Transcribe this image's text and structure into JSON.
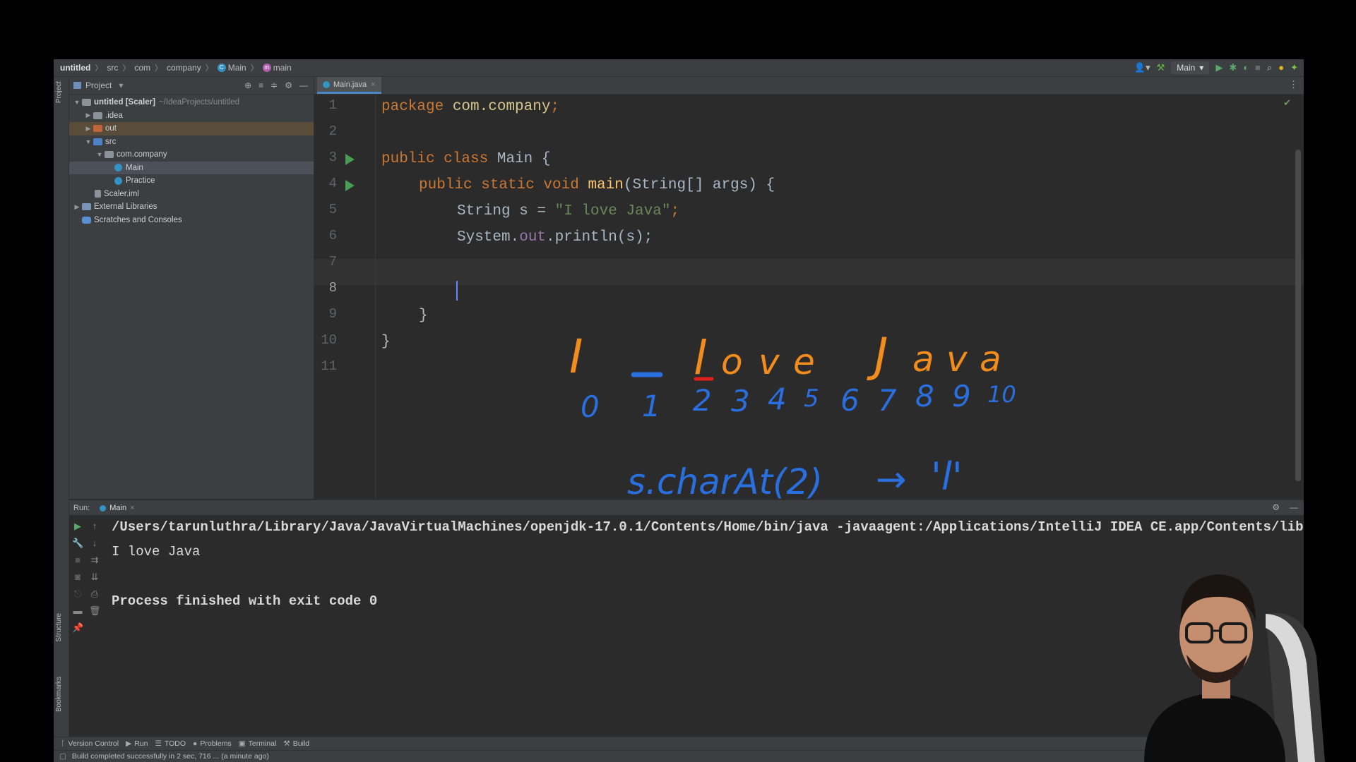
{
  "breadcrumb": [
    "untitled",
    "src",
    "com",
    "company",
    "Main",
    "main"
  ],
  "toolbar": {
    "run_config": "Main"
  },
  "project_panel": {
    "title": "Project",
    "tree": [
      {
        "label": "untitled [Scaler]",
        "path": "~/IdeaProjects/untitled"
      },
      {
        "label": ".idea"
      },
      {
        "label": "out"
      },
      {
        "label": "src"
      },
      {
        "label": "com.company"
      },
      {
        "label": "Main"
      },
      {
        "label": "Practice"
      },
      {
        "label": "Scaler.iml"
      },
      {
        "label": "External Libraries"
      },
      {
        "label": "Scratches and Consoles"
      }
    ]
  },
  "side_labels": {
    "project": "Project",
    "structure": "Structure",
    "bookmarks": "Bookmarks"
  },
  "editor": {
    "tab": "Main.java",
    "line_numbers": [
      "1",
      "2",
      "3",
      "4",
      "5",
      "6",
      "7",
      "8",
      "9",
      "10",
      "11"
    ],
    "code": {
      "l1_kw": "package",
      "l1_pkg": "com.company",
      "l1_end": ";",
      "l3_kw": "public class",
      "l3_name": "Main {",
      "l4_kw": "public static void",
      "l4_m": "main",
      "l4_rest": "(String[] args) {",
      "l5_a": "String s = ",
      "l5_str": "\"I love Java\"",
      "l5_end": ";",
      "l6_a": "System.",
      "l6_f": "out",
      "l6_b": ".println(s);",
      "l9": "}",
      "l10": "}"
    }
  },
  "annotation": {
    "letters": [
      "I",
      "l",
      "o",
      "v",
      "e",
      "J",
      "a",
      "v",
      "a"
    ],
    "indices": [
      "0",
      "1",
      "2",
      "3",
      "4",
      "5",
      "6",
      "7",
      "8",
      "9",
      "10"
    ],
    "expression": "s.charAt(2)",
    "arrow": "→",
    "result": "'l'"
  },
  "run_panel": {
    "label": "Run:",
    "tab": "Main",
    "command": "/Users/tarunluthra/Library/Java/JavaVirtualMachines/openjdk-17.0.1/Contents/Home/bin/java -javaagent:/Applications/IntelliJ IDEA CE.app/Contents/lib/ide",
    "output": "I love Java",
    "finished": "Process finished with exit code 0"
  },
  "bottom_tabs": [
    "Version Control",
    "Run",
    "TODO",
    "Problems",
    "Terminal",
    "Build"
  ],
  "status_text": "Build completed successfully in 2 sec, 716 ... (a minute ago)",
  "colors": {
    "keyword": "#cc7832",
    "method": "#ffc66d",
    "string": "#6a8759",
    "field": "#9876aa",
    "run_gutter": "#499c54",
    "pen_orange": "#f28c1d",
    "pen_blue": "#2a6fe0",
    "pen_red": "#e02020"
  }
}
